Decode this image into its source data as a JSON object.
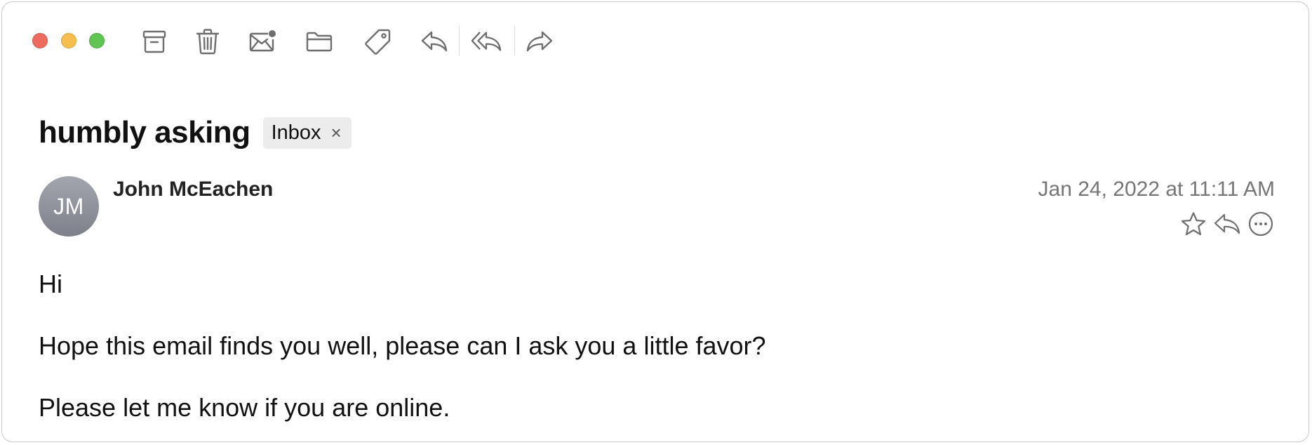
{
  "window": {
    "traffic_lights": [
      "close",
      "minimize",
      "maximize"
    ]
  },
  "toolbar": {
    "buttons": [
      {
        "name": "archive",
        "icon": "archive-icon"
      },
      {
        "name": "delete",
        "icon": "trash-icon"
      },
      {
        "name": "mark-unread",
        "icon": "envelope-unread-icon"
      },
      {
        "name": "move",
        "icon": "folder-icon"
      },
      {
        "name": "tag",
        "icon": "tag-icon"
      },
      {
        "name": "reply",
        "icon": "reply-icon"
      },
      {
        "name": "reply-all",
        "icon": "reply-all-icon"
      },
      {
        "name": "forward",
        "icon": "forward-icon"
      }
    ]
  },
  "message": {
    "subject": "humbly asking",
    "mailbox_tag": {
      "label": "Inbox",
      "close_glyph": "×"
    },
    "sender": {
      "name": "John McEachen",
      "initials": "JM"
    },
    "date": "Jan 24, 2022 at 11:11 AM",
    "actions": [
      {
        "name": "flag",
        "icon": "star-icon"
      },
      {
        "name": "reply",
        "icon": "reply-icon"
      },
      {
        "name": "more",
        "icon": "ellipsis-circle-icon"
      }
    ],
    "body": [
      "Hi",
      "Hope this email finds you well, please can I ask you a little favor?",
      "Please let me know if you are online."
    ]
  },
  "colors": {
    "close": "#ed6a5e",
    "minimize": "#f5bf4f",
    "maximize": "#61c554",
    "icon_gray": "#6e6e6e",
    "date_gray": "#767676",
    "tag_bg": "#ececec"
  }
}
